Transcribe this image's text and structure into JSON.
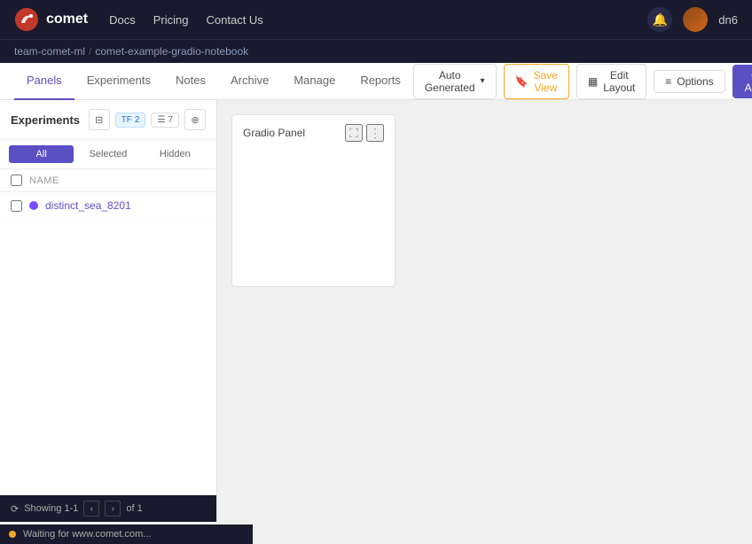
{
  "navbar": {
    "brand": "comet",
    "links": [
      "Docs",
      "Pricing",
      "Contact Us"
    ],
    "username": "dn6",
    "notification_icon": "🔔"
  },
  "breadcrumb": {
    "parent": "team-comet-ml",
    "separator": "/",
    "child": "comet-example-gradio-notebook"
  },
  "tabs": {
    "items": [
      {
        "label": "Panels",
        "active": true
      },
      {
        "label": "Experiments",
        "active": false
      },
      {
        "label": "Notes",
        "active": false
      },
      {
        "label": "Archive",
        "active": false
      },
      {
        "label": "Manage",
        "active": false
      },
      {
        "label": "Reports",
        "active": false
      }
    ],
    "view_dropdown": "Auto Generated",
    "save_view": "Save View",
    "edit_layout": "Edit Layout",
    "options": "Options",
    "add": "+ Add"
  },
  "sidebar": {
    "title": "Experiments",
    "controls": {
      "filter_icon": "⚙",
      "tf_badge": "TF",
      "tf_count": "2",
      "list_icon": "☰",
      "list_count": "7",
      "settings_icon": "⋯"
    },
    "filter_tabs": [
      "All",
      "Selected",
      "Hidden"
    ],
    "active_filter": "All",
    "table_header": "NAME",
    "experiments": [
      {
        "name": "distinct_sea_8201",
        "color": "#7c4dff",
        "checked": false
      }
    ],
    "footer": {
      "showing": "Showing 1-1",
      "of": "of 1",
      "url": "Waiting for www.comet.com..."
    }
  },
  "panel": {
    "title": "Gradio Panel",
    "expand_icon": "⛶",
    "menu_icon": "⋮"
  }
}
